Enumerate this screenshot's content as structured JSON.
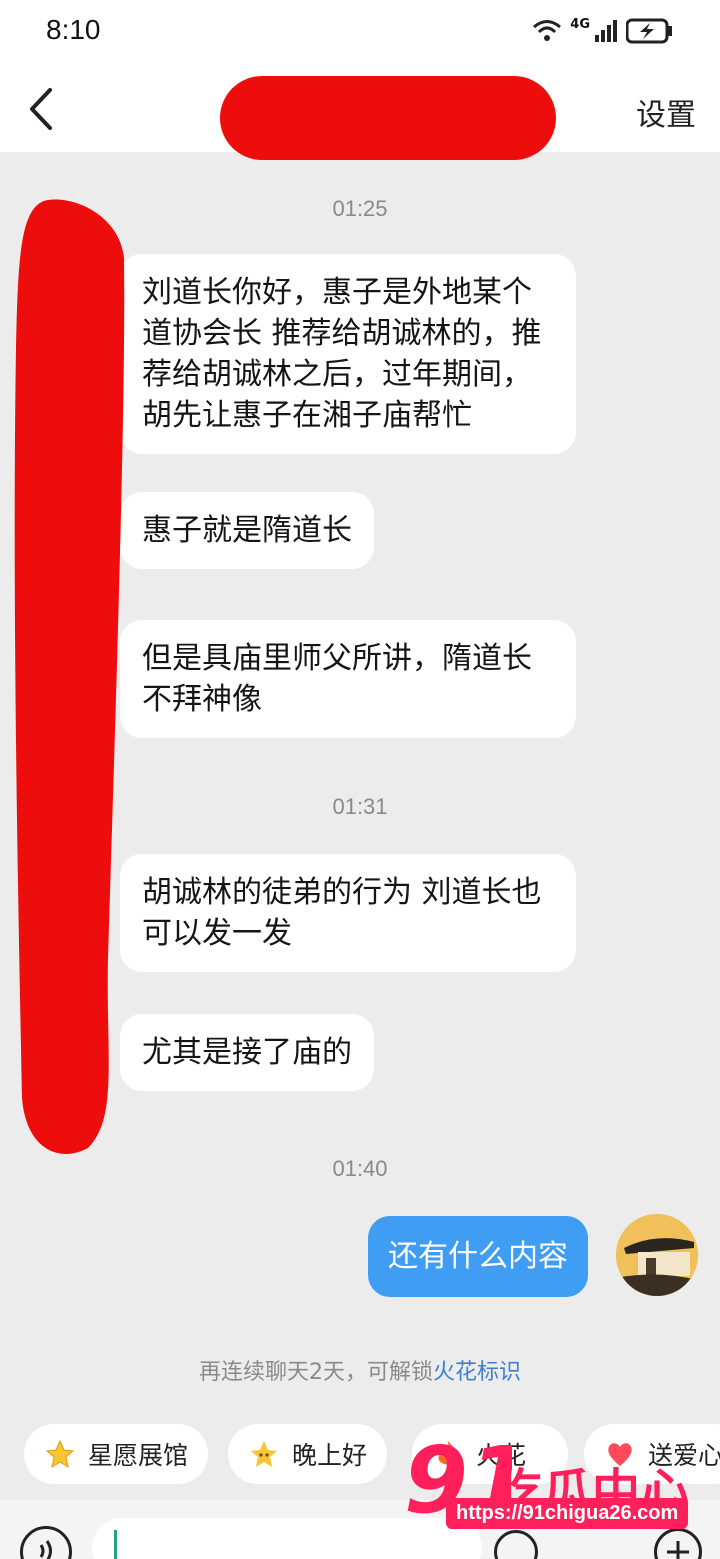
{
  "status_bar": {
    "time": "8:10",
    "network": "4G"
  },
  "nav": {
    "settings_label": "设置"
  },
  "messages": [
    {
      "time": "01:25"
    },
    {
      "from": "them",
      "text": "刘道长你好，惠子是外地某个道协会长 推荐给胡诚林的，推荐给胡诚林之后，过年期间，胡先让惠子在湘子庙帮忙"
    },
    {
      "from": "them",
      "text": "惠子就是隋道长"
    },
    {
      "from": "them",
      "text": "但是具庙里师父所讲，隋道长不拜神像"
    },
    {
      "time": "01:31"
    },
    {
      "from": "them",
      "text": "胡诚林的徒弟的行为 刘道长也可以发一发"
    },
    {
      "from": "them",
      "text": "尤其是接了庙的"
    },
    {
      "time": "01:40"
    },
    {
      "from": "me",
      "text": "还有什么内容"
    }
  ],
  "spark_hint": {
    "text": "再连续聊天2天，可解锁",
    "link": "火花标识"
  },
  "quick_replies": [
    {
      "label": "星愿展馆",
      "icon": "star-icon"
    },
    {
      "label": "晚上好",
      "icon": "star-face-icon"
    },
    {
      "label": "火花",
      "icon": "fire-icon"
    },
    {
      "label": "送爱心",
      "icon": "heart-icon"
    }
  ],
  "input": {
    "placeholder": ""
  },
  "watermark": {
    "brand": "吃瓜中心",
    "number": "91",
    "url": "https://91chigua26.com"
  },
  "colors": {
    "redaction": "#ee0d0d",
    "outgoing_bubble": "#3f9df4",
    "link": "#3e7fd3",
    "watermark": "#ff1f5a"
  }
}
